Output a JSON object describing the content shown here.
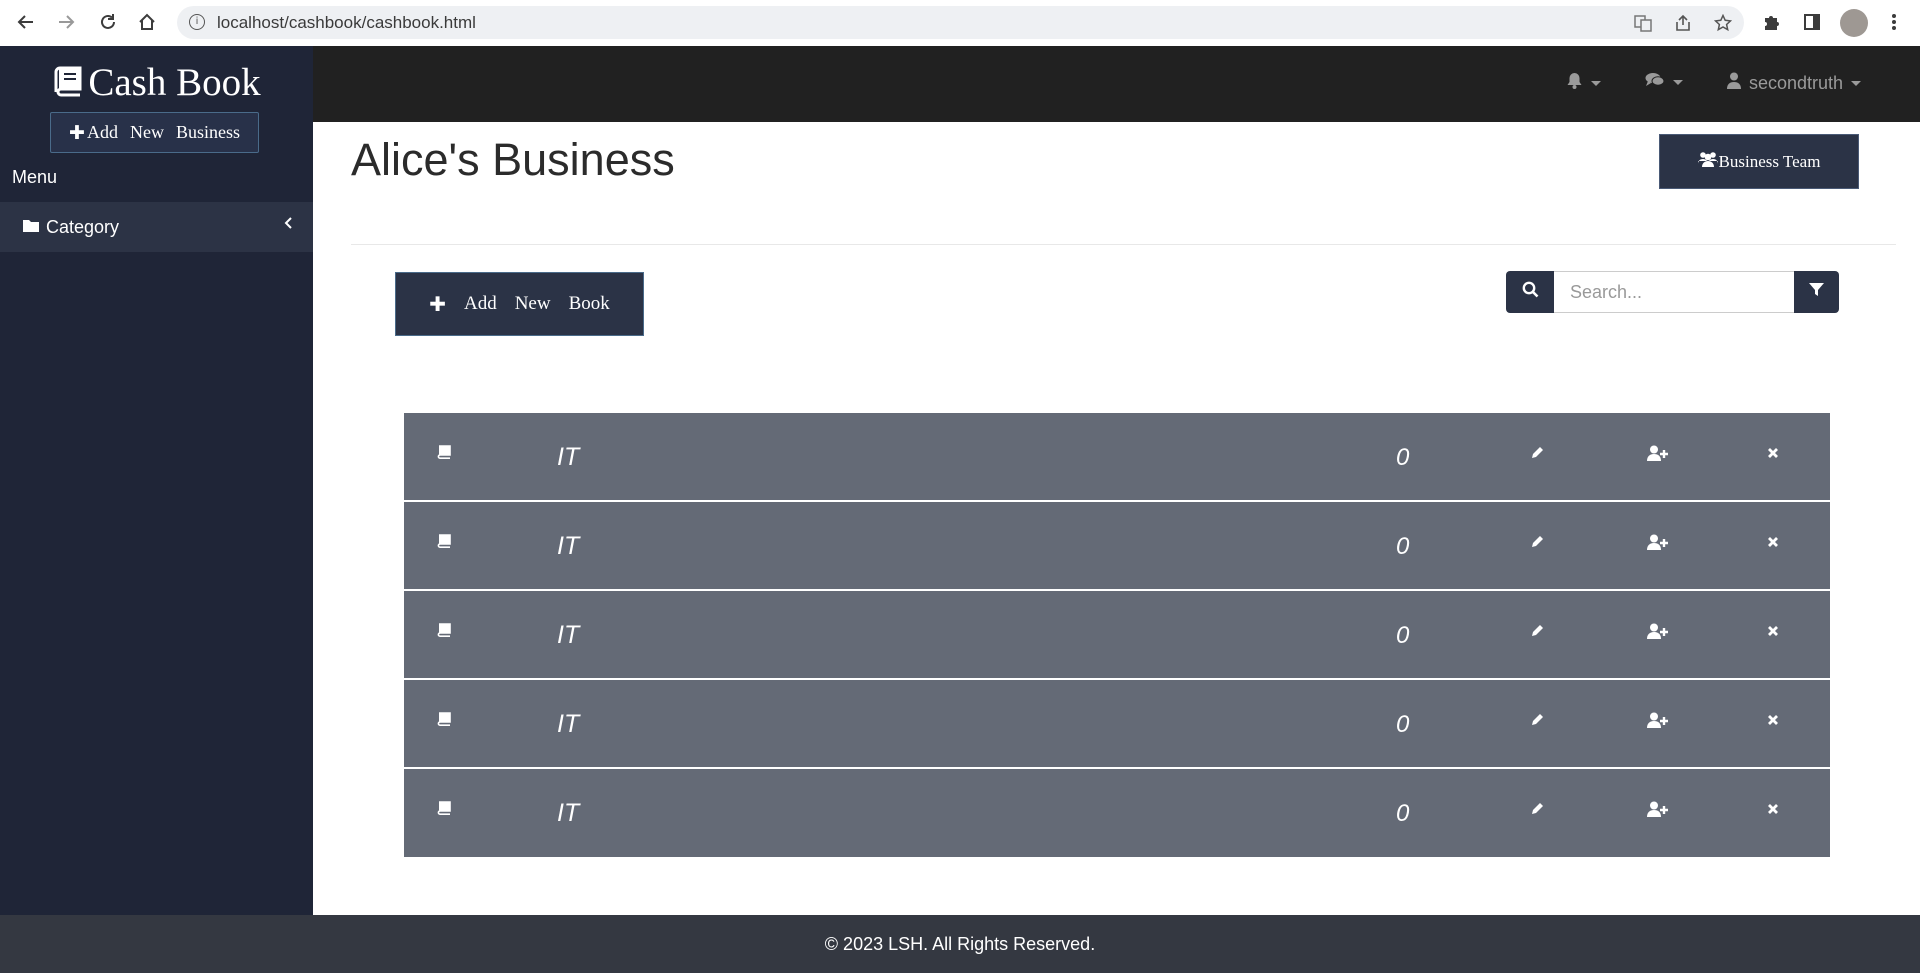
{
  "browser": {
    "url": "localhost/cashbook/cashbook.html"
  },
  "sidebar": {
    "brand": "Cash Book",
    "add_business_words": [
      "Add",
      "New",
      "Business"
    ],
    "menu_label": "Menu",
    "items": [
      {
        "label": "Category"
      }
    ]
  },
  "topbar": {
    "username": "secondtruth"
  },
  "main": {
    "title": "Alice's Business",
    "team_button": "Business Team",
    "add_book_words": [
      "Add",
      "New",
      "Book"
    ],
    "search_placeholder": "Search...",
    "books": [
      {
        "name": "IT",
        "count": "0"
      },
      {
        "name": "IT",
        "count": "0"
      },
      {
        "name": "IT",
        "count": "0"
      },
      {
        "name": "IT",
        "count": "0"
      },
      {
        "name": "IT",
        "count": "0"
      }
    ]
  },
  "footer": {
    "text": "© 2023 LSH. All Rights Reserved."
  },
  "colors": {
    "sidebar_bg": "#1f2537",
    "topbar_bg": "#212121",
    "button_bg": "#2b3346",
    "row_bg": "#646a76",
    "footer_bg": "#343841"
  }
}
